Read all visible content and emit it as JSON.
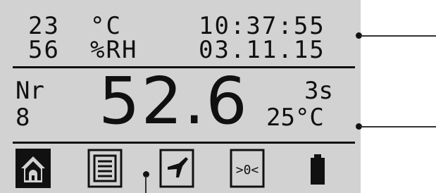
{
  "status": {
    "temperature": "23",
    "temperature_unit": "°C",
    "humidity": "56",
    "humidity_unit": "%RH",
    "time": "10:37:55",
    "date": "03.11.15"
  },
  "measurement": {
    "nr_label": "Nr",
    "nr_value": "8",
    "value": "52.6",
    "duration": "3s",
    "probe_temperature": "25°C"
  },
  "toolbar": {
    "items": [
      {
        "name": "home",
        "icon": "home-icon"
      },
      {
        "name": "list",
        "icon": "list-icon"
      },
      {
        "name": "probe",
        "icon": "probe-icon"
      },
      {
        "name": "zero",
        "icon": "zero-icon",
        "label": ">0<"
      },
      {
        "name": "battery",
        "icon": "battery-icon"
      }
    ]
  },
  "colors": {
    "lcd_background": "#d2d2d2",
    "lcd_text": "#101010",
    "page_background": "#ffffff"
  }
}
